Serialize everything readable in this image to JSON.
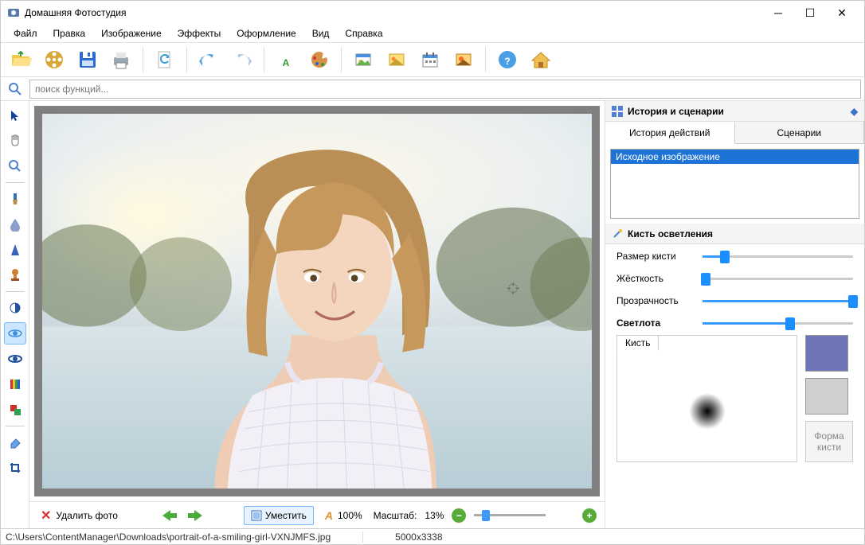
{
  "app": {
    "title": "Домашняя Фотостудия"
  },
  "menu": [
    "Файл",
    "Правка",
    "Изображение",
    "Эффекты",
    "Оформление",
    "Вид",
    "Справка"
  ],
  "search": {
    "placeholder": "поиск функций..."
  },
  "right": {
    "history_header": "История и сценарии",
    "tabs": {
      "history": "История действий",
      "scenarios": "Сценарии"
    },
    "history_items": [
      "Исходное изображение"
    ],
    "brush_header": "Кисть осветления",
    "params": {
      "size_label": "Размер кисти",
      "hardness_label": "Жёсткость",
      "opacity_label": "Прозрачность",
      "lightness_label": "Светлота",
      "size_pct": 15,
      "hardness_pct": 2,
      "opacity_pct": 100,
      "lightness_pct": 58
    },
    "preview_tab": "Кисть",
    "shape_btn": "Форма\nкисти",
    "color_primary": "#6e74b8",
    "color_secondary": "#d0d0d0"
  },
  "bottom": {
    "delete_label": "Удалить фото",
    "fit_label": "Уместить",
    "reset_zoom": "100%",
    "scale_label": "Масштаб:",
    "scale_value": "13%"
  },
  "status": {
    "path": "C:\\Users\\ContentManager\\Downloads\\portrait-of-a-smiling-girl-VXNJMFS.jpg",
    "dimensions": "5000x3338"
  }
}
